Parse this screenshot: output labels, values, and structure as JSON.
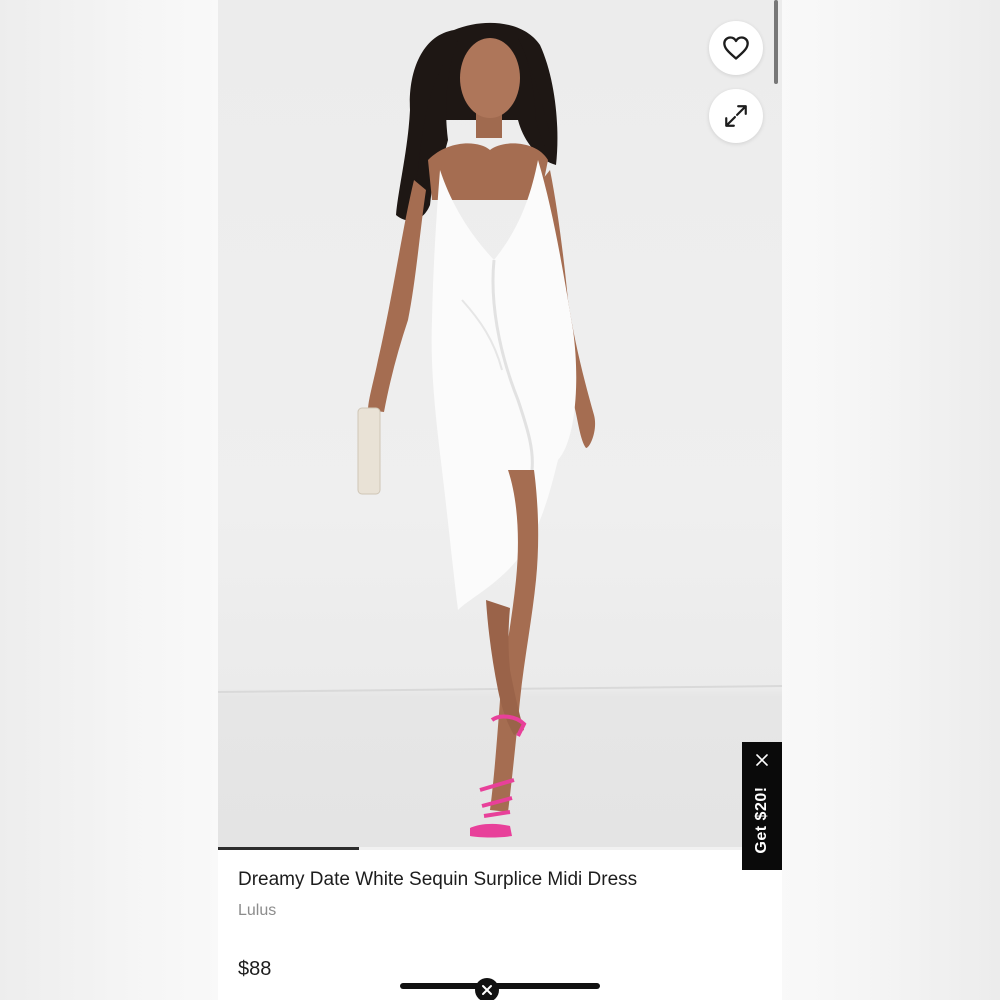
{
  "product": {
    "title": "Dreamy Date White Sequin Surplice Midi Dress",
    "brand": "Lulus",
    "price": "$88"
  },
  "gallery": {
    "progress": 0.25
  },
  "actions": {
    "favorite_icon": "heart-icon",
    "expand_icon": "expand-icon",
    "dismiss_icon": "close-icon"
  },
  "promo": {
    "label": "Get $20!",
    "close_icon": "close-icon"
  },
  "colors": {
    "promo_bg": "#0a0a0a",
    "text": "#1d1d1d",
    "muted": "#8c8c8c",
    "shoe_pink": "#e8409a"
  }
}
